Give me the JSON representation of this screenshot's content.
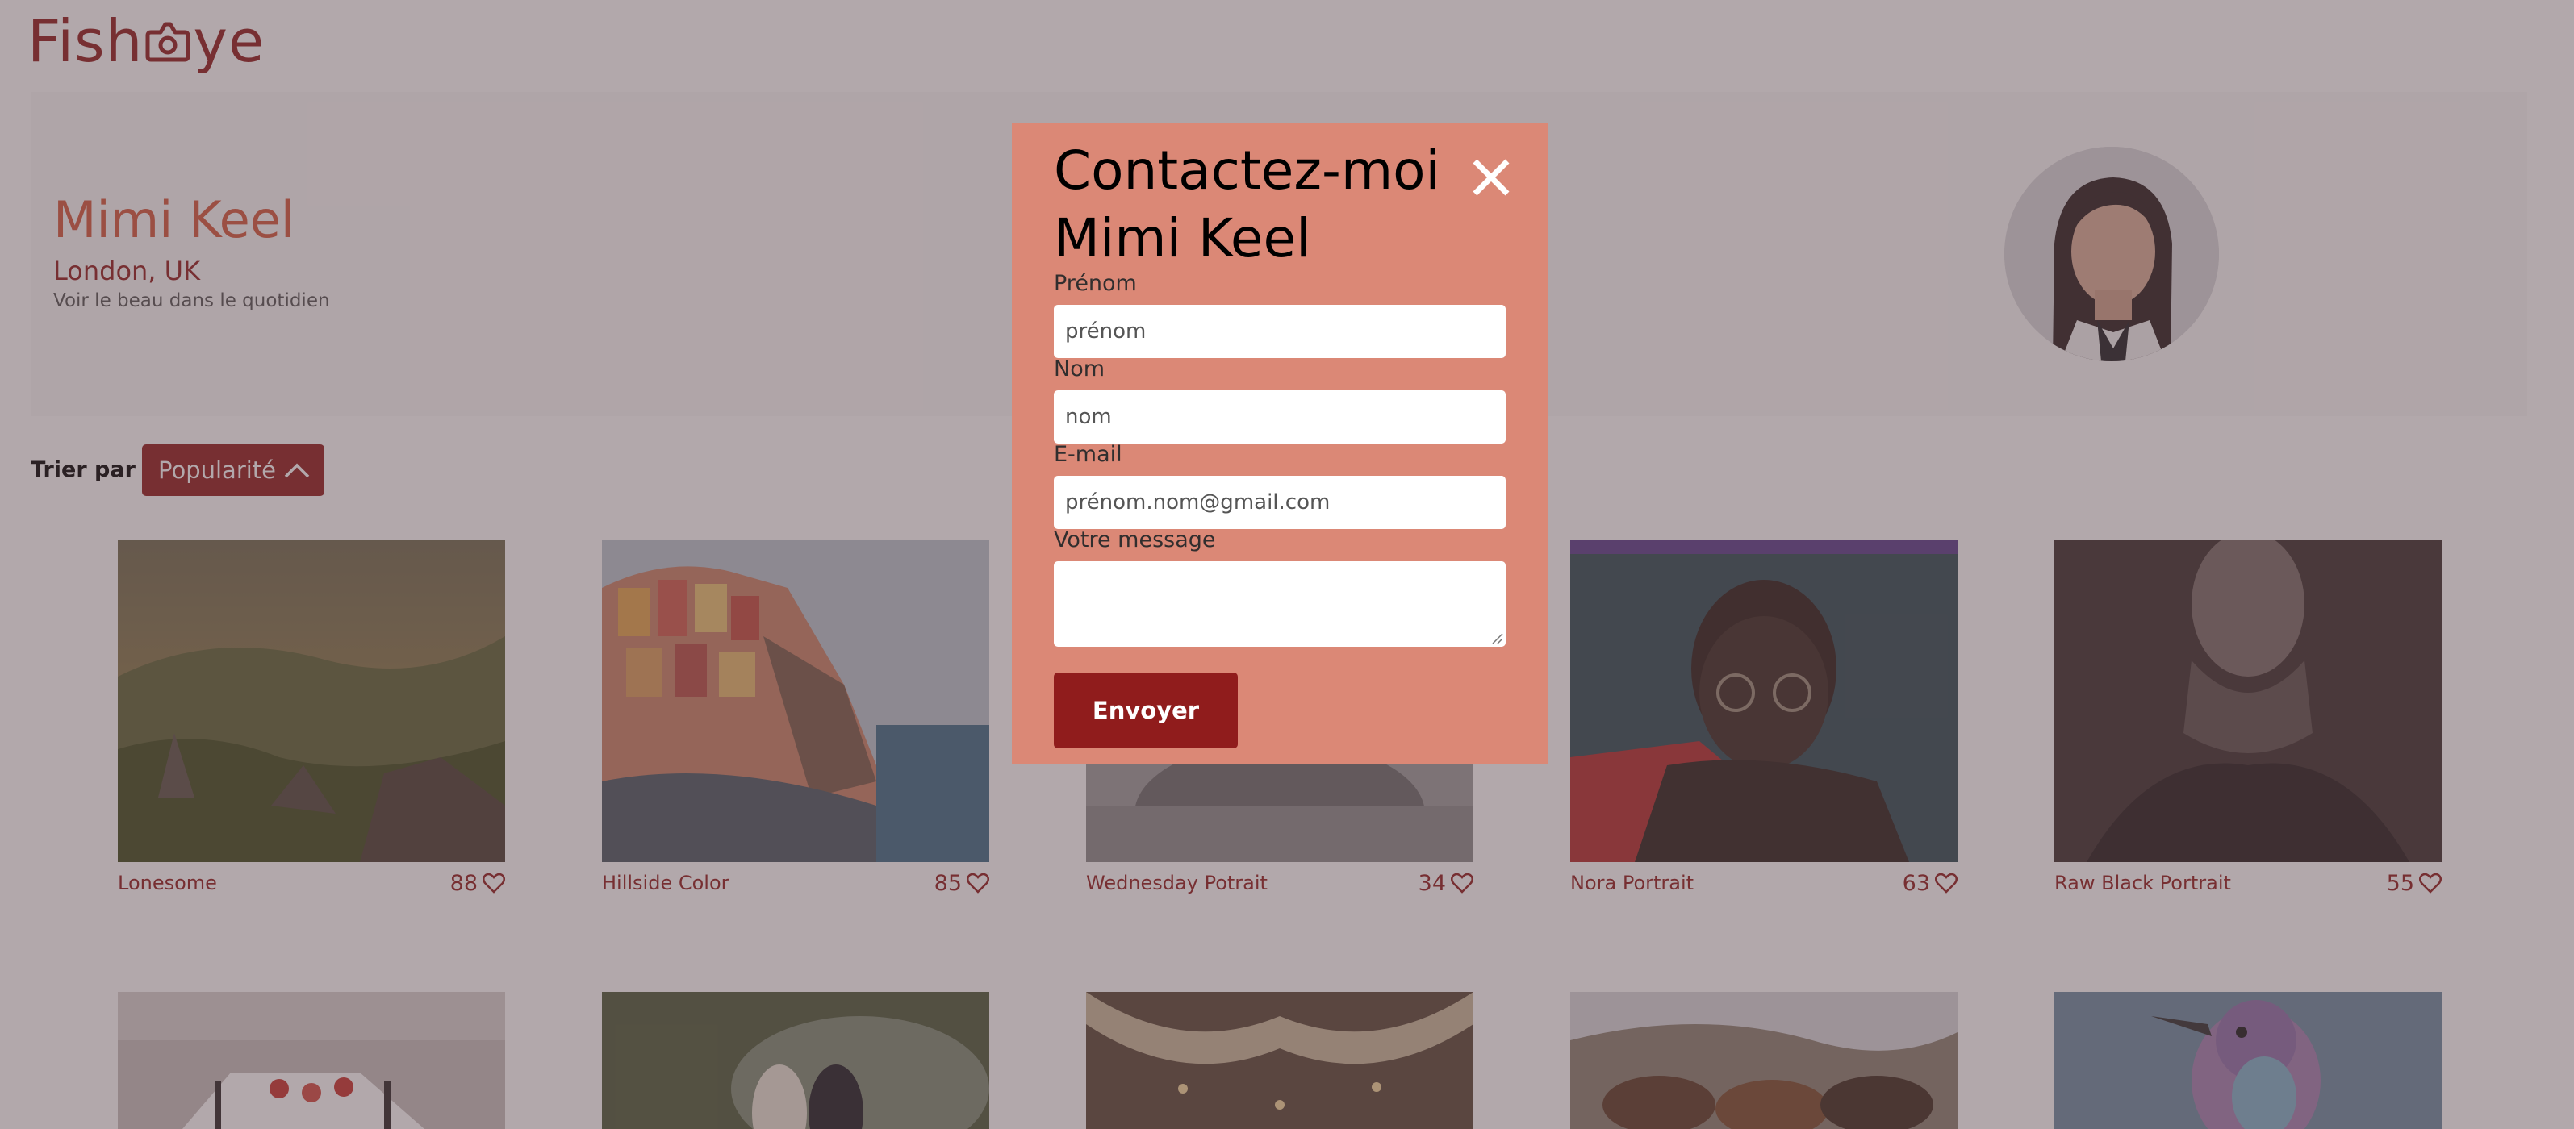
{
  "logo": {
    "text_left": "Fish",
    "text_right": "ye"
  },
  "photographer": {
    "name": "Mimi Keel",
    "location": "London, UK",
    "tagline": "Voir le beau dans le quotidien"
  },
  "sort": {
    "label": "Trier par",
    "selected": "Popularité"
  },
  "gallery": [
    {
      "title": "Lonesome",
      "likes": "88"
    },
    {
      "title": "Hillside Color",
      "likes": "85"
    },
    {
      "title": "Wednesday Potrait",
      "likes": "34"
    },
    {
      "title": "Nora Portrait",
      "likes": "63"
    },
    {
      "title": "Raw Black Portrait",
      "likes": "55"
    }
  ],
  "modal": {
    "title_line1": "Contactez-moi",
    "title_line2": "Mimi Keel",
    "fields": [
      {
        "label": "Prénom",
        "placeholder": "prénom"
      },
      {
        "label": "Nom",
        "placeholder": "nom"
      },
      {
        "label": "E-mail",
        "placeholder": "prénom.nom@gmail.com"
      },
      {
        "label": "Votre message",
        "placeholder": ""
      }
    ],
    "submit_label": "Envoyer"
  },
  "colors": {
    "brand": "#901c1c",
    "name_accent": "#d3573c",
    "modal_bg": "#db8876",
    "header_bg": "#fafafa"
  }
}
